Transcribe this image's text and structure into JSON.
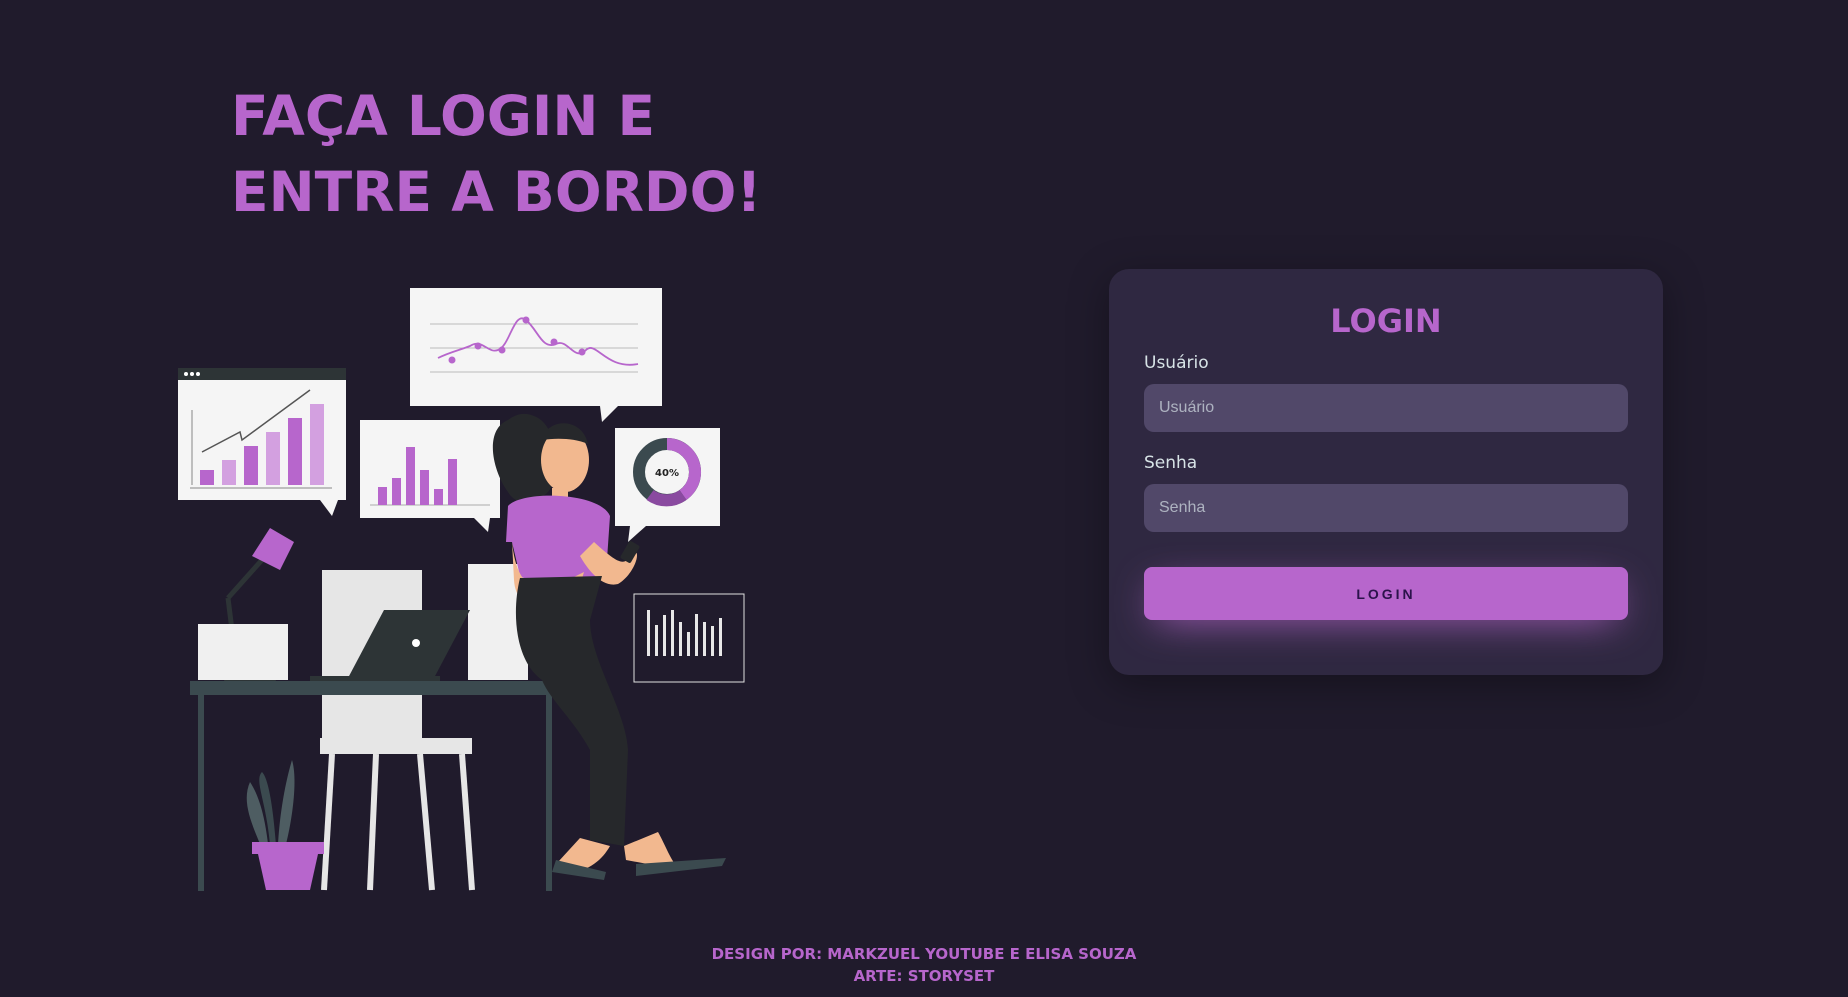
{
  "headline": {
    "line1": "FAÇA LOGIN E",
    "line2": "ENTRE A BORDO!"
  },
  "illustration": {
    "donut_label": "40%"
  },
  "login": {
    "title": "LOGIN",
    "username_label": "Usuário",
    "username_placeholder": "Usuário",
    "username_value": "",
    "password_label": "Senha",
    "password_placeholder": "Senha",
    "password_value": "",
    "button_label": "LOGIN"
  },
  "footer": {
    "credits": "DESIGN POR: MARKZUEL YOUTUBE E ELISA SOUZA",
    "art": "ARTE: STORYSET"
  },
  "colors": {
    "background": "#201b2c",
    "card": "#2f2841",
    "accent": "#b766cc",
    "input": "#514869"
  }
}
